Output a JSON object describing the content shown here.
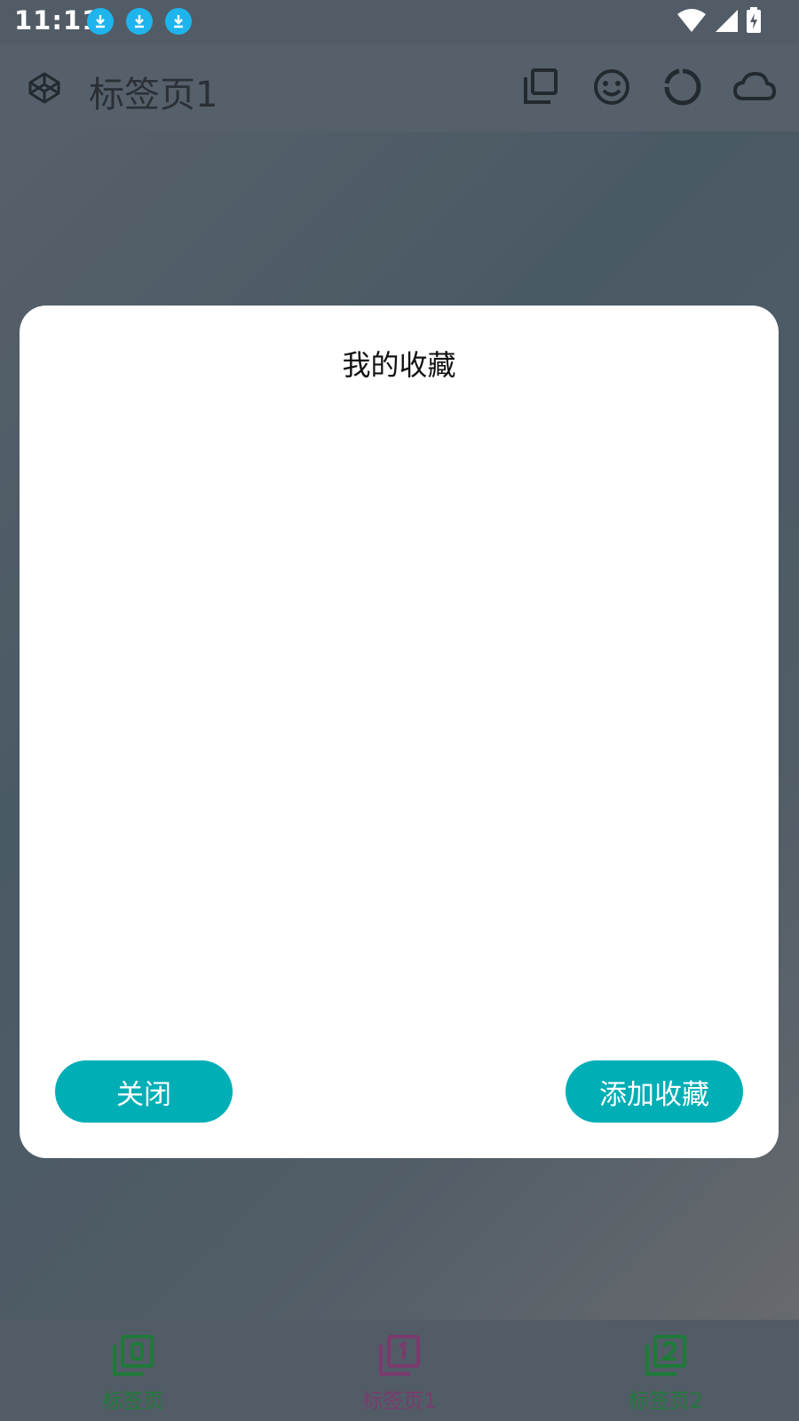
{
  "status_bar": {
    "time": "11:11",
    "notification_icons": [
      "download-icon",
      "download-icon",
      "download-icon"
    ],
    "accent_color": "#1eb4ee"
  },
  "toolbar": {
    "title": "标签页1",
    "actions": [
      "copy-icon",
      "smile-icon",
      "loading-ring-icon",
      "cloud-icon"
    ]
  },
  "dialog": {
    "title": "我的收藏",
    "close_label": "关闭",
    "add_label": "添加收藏",
    "button_color": "#00aeb6"
  },
  "bottom_nav": {
    "items": [
      {
        "label": "标签页",
        "color": "#1f7a3a",
        "icon": "filter-0-icon"
      },
      {
        "label": "标签页1",
        "color": "#7a3a6e",
        "icon": "filter-1-icon"
      },
      {
        "label": "标签页2",
        "color": "#1f7a3a",
        "icon": "filter-2-icon"
      }
    ]
  }
}
